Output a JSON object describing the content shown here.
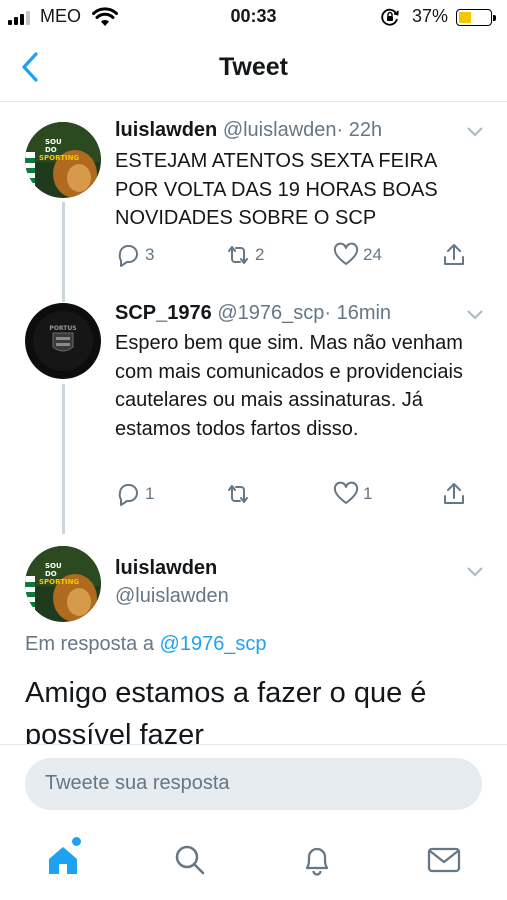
{
  "status_bar": {
    "carrier": "MEO",
    "time": "00:33",
    "battery": "37%"
  },
  "header": {
    "title": "Tweet"
  },
  "tweets": [
    {
      "name": "luislawden",
      "handle": "@luislawden",
      "time": "· 22h",
      "text": "ESTEJAM ATENTOS SEXTA FEIRA POR VOLTA DAS 19 HORAS BOAS NOVIDADES SOBRE O SCP",
      "replies": "3",
      "retweets": "2",
      "likes": "24",
      "avatar_text": {
        "line1": "SOU",
        "line2": "DO",
        "line3": "SPORTING"
      }
    },
    {
      "name": "SCP_1976",
      "handle": "@1976_scp",
      "time": "· 16min",
      "text": "Espero bem que sim. Mas não venham com mais comunicados e providenciais cautelares ou mais assinaturas. Já estamos todos fartos disso.",
      "replies": "1",
      "retweets": "",
      "likes": "1",
      "avatar_text": {
        "line1": "PORTUS"
      }
    }
  ],
  "focus": {
    "name": "luislawden",
    "handle": "@luislawden",
    "reply_label": "Em resposta a",
    "reply_mention": "@1976_scp",
    "text": "Amigo estamos a fazer o que é possível fazer",
    "avatar_text": {
      "line1": "SOU",
      "line2": "DO",
      "line3": "SPORTING"
    }
  },
  "composer": {
    "placeholder": "Tweete sua resposta"
  },
  "colors": {
    "accent": "#1da1f2",
    "secondary_text": "#657786",
    "divider": "#e1e8ed"
  },
  "tabbar": {
    "items": [
      "home-icon",
      "search-icon",
      "notifications-icon",
      "messages-icon"
    ]
  }
}
